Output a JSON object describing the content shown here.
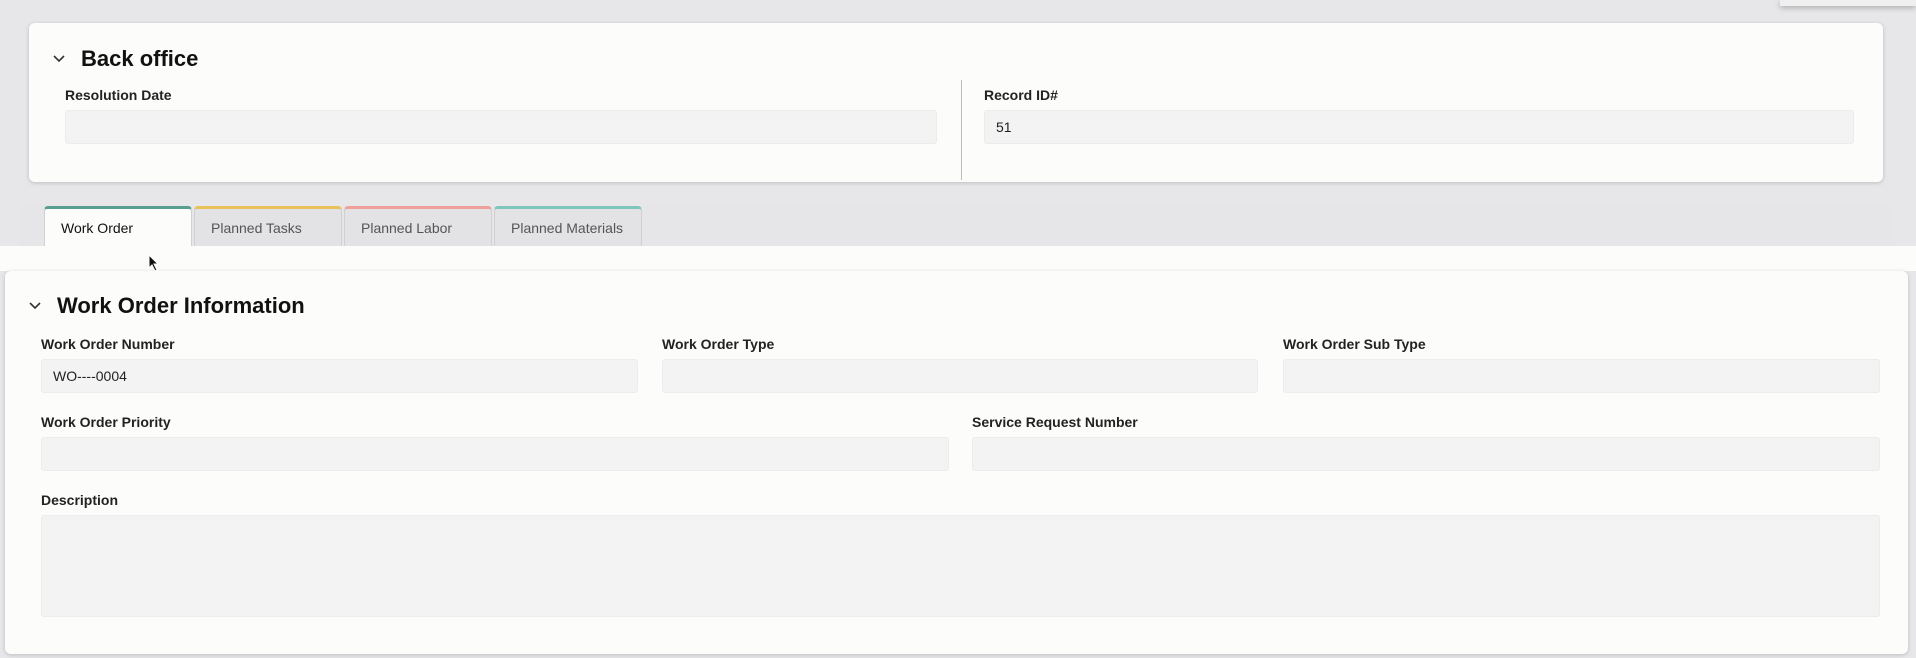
{
  "back_office": {
    "title": "Back office",
    "resolution_date": {
      "label": "Resolution Date",
      "value": ""
    },
    "record_id": {
      "label": "Record ID#",
      "value": "51"
    }
  },
  "tabs": [
    {
      "label": "Work Order",
      "color": "#5a9e8f",
      "active": true
    },
    {
      "label": "Planned Tasks",
      "color": "#e8c15a",
      "active": false
    },
    {
      "label": "Planned Labor",
      "color": "#f0a09a",
      "active": false
    },
    {
      "label": "Planned Materials",
      "color": "#7cc6bd",
      "active": false
    }
  ],
  "work_order_info": {
    "title": "Work Order Information",
    "number": {
      "label": "Work Order Number",
      "value": "WO----0004"
    },
    "type": {
      "label": "Work Order Type",
      "value": ""
    },
    "sub_type": {
      "label": "Work Order Sub Type",
      "value": ""
    },
    "priority": {
      "label": "Work Order Priority",
      "value": ""
    },
    "service_request": {
      "label": "Service Request Number",
      "value": ""
    },
    "description": {
      "label": "Description",
      "value": ""
    }
  }
}
